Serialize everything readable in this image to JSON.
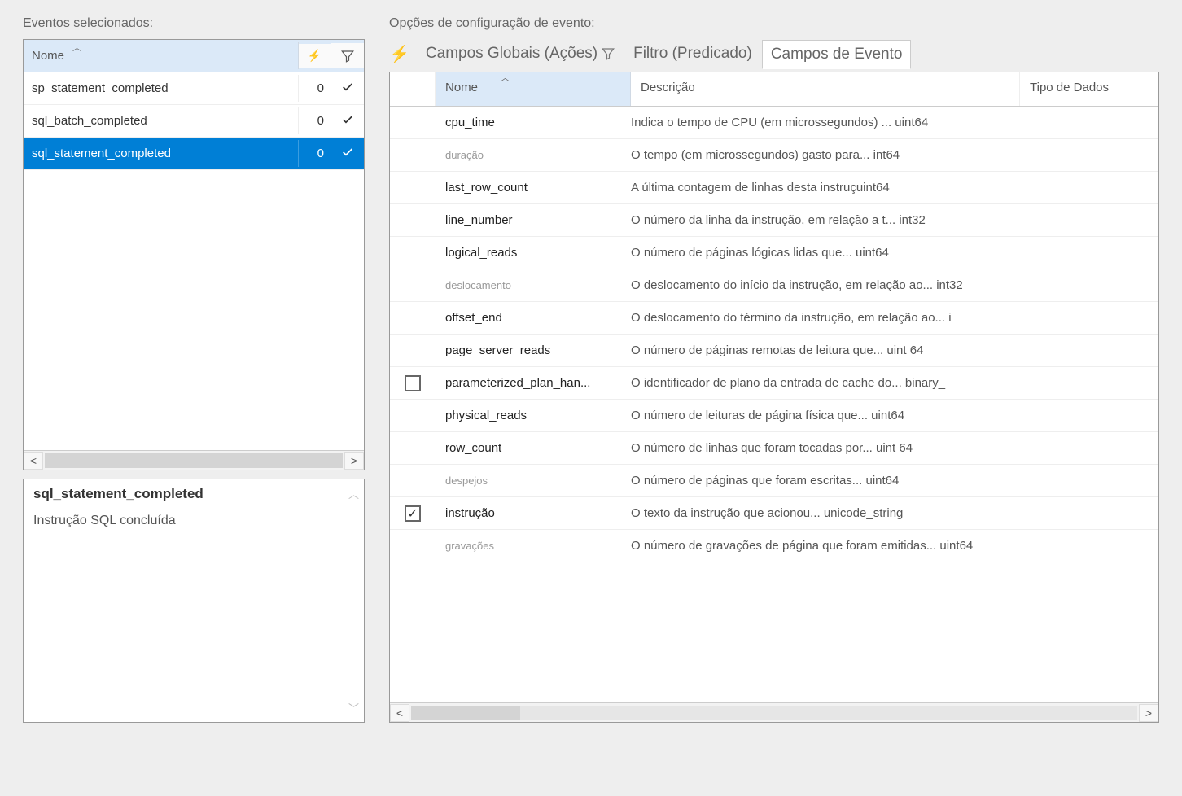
{
  "labels": {
    "selected_events": "Eventos selecionados:",
    "config_options": "Opções de configuração de evento:"
  },
  "events_grid": {
    "columns": {
      "name": "Nome"
    },
    "rows": [
      {
        "name": "sp_statement_completed",
        "count": "0",
        "checked": true,
        "selected": false
      },
      {
        "name": "sql_batch_completed",
        "count": "0",
        "checked": true,
        "selected": false
      },
      {
        "name": "sql_statement_completed",
        "count": "0",
        "checked": true,
        "selected": true
      }
    ]
  },
  "detail": {
    "title": "sql_statement_completed",
    "description": "Instrução SQL concluída"
  },
  "tabs": {
    "global": "Campos Globais (Ações)",
    "filter": "Filtro (Predicado)",
    "event_fields": "Campos de Evento"
  },
  "fields_grid": {
    "columns": {
      "name": "Nome",
      "desc": "Descrição",
      "type": "Tipo de Dados"
    },
    "rows": [
      {
        "chk": null,
        "name": "cpu_time",
        "dim": false,
        "desc": "Indica o tempo de CPU (em microssegundos) ... uint64"
      },
      {
        "chk": null,
        "name": "duração",
        "dim": true,
        "desc": "O tempo (em microssegundos) gasto para... int64"
      },
      {
        "chk": null,
        "name": "last_row_count",
        "dim": false,
        "desc": "A última contagem de linhas desta instruçuint64"
      },
      {
        "chk": null,
        "name": "line_number",
        "dim": false,
        "desc": "O número da linha da instrução, em relação a t... int32"
      },
      {
        "chk": null,
        "name": "logical_reads",
        "dim": false,
        "desc": "O número de páginas lógicas lidas que... uint64"
      },
      {
        "chk": null,
        "name": "deslocamento",
        "dim": true,
        "desc": "O deslocamento do início da instrução, em relação ao... int32"
      },
      {
        "chk": null,
        "name": "offset_end",
        "dim": false,
        "desc": "O deslocamento do término da instrução, em relação ao... i"
      },
      {
        "chk": null,
        "name": "page_server_reads",
        "dim": false,
        "desc": "O número de páginas remotas de leitura que... uint 64"
      },
      {
        "chk": false,
        "name": "parameterized_plan_han...",
        "dim": false,
        "desc": "O identificador de plano da entrada de cache do... binary_"
      },
      {
        "chk": null,
        "name": "physical_reads",
        "dim": false,
        "desc": "O número de leituras de página física que... uint64"
      },
      {
        "chk": null,
        "name": "row_count",
        "dim": false,
        "desc": "O número de linhas que foram tocadas por... uint 64"
      },
      {
        "chk": null,
        "name": "despejos",
        "dim": true,
        "desc": "O número de páginas que foram escritas... uint64"
      },
      {
        "chk": true,
        "name": "instrução",
        "dim": false,
        "desc": "O texto da instrução que acionou... unicode_string"
      },
      {
        "chk": null,
        "name": "gravações",
        "dim": true,
        "desc": "O número de gravações de página que foram emitidas... uint64"
      }
    ]
  }
}
